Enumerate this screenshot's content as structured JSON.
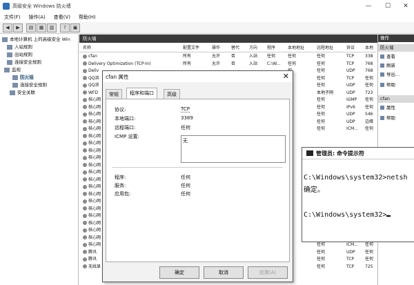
{
  "window": {
    "title": "高级安全 Windows 防火墙",
    "controls": [
      "—",
      "☐",
      "✕"
    ]
  },
  "menu": [
    "文件(F)",
    "操作(A)",
    "查看(V)",
    "帮助(H)"
  ],
  "toolbar": [
    "◀",
    "▶",
    "▤",
    "▦",
    "▥",
    "?",
    "▣"
  ],
  "tree": [
    {
      "label": "本地计算机 上的高级安全 Win"
    },
    {
      "label": "入站规则"
    },
    {
      "label": "出站规则"
    },
    {
      "label": "连接安全规则"
    },
    {
      "label": "监视"
    },
    {
      "label": "防火墙"
    },
    {
      "label": "连接安全规则"
    },
    {
      "label": "安全关联"
    }
  ],
  "main": {
    "header": "防火墙",
    "columns": [
      "名称",
      "配置文件",
      "操作",
      "替代",
      "方向",
      "程序",
      "本地地址",
      "远程地址",
      "协议",
      "本地"
    ],
    "rows": [
      [
        "cfan",
        "所有",
        "允许",
        "否",
        "入站",
        "任何",
        "任何",
        "任何",
        "TCP",
        "338"
      ],
      [
        "Delivery Optimization (TCP-In)",
        "所有",
        "允许",
        "否",
        "入站",
        "C:\\W...",
        "任何",
        "任何",
        "TCP",
        "768"
      ],
      [
        "Deliv",
        "",
        "",
        "",
        "",
        "",
        "何",
        "任何",
        "UDP",
        "768"
      ],
      [
        "QQ浏",
        "",
        "",
        "",
        "",
        "",
        "何",
        "任何",
        "TCP",
        "任何"
      ],
      [
        "QQ浏",
        "",
        "",
        "",
        "",
        "",
        "何",
        "任何",
        "UDP",
        "任何"
      ],
      [
        "WFD",
        "",
        "",
        "",
        "",
        "",
        "何",
        "本地子网",
        "UDP",
        "723"
      ],
      [
        "核心网",
        "",
        "",
        "",
        "",
        "",
        "何",
        "任何",
        "IGMP",
        "任何"
      ],
      [
        "核心网",
        "",
        "",
        "",
        "",
        "",
        "何",
        "任何",
        "IPv6",
        "任何"
      ],
      [
        "核心网",
        "",
        "",
        "",
        "",
        "",
        "何",
        "任何",
        "UDP",
        "546"
      ],
      [
        "核心网",
        "",
        "",
        "",
        "",
        "",
        "何",
        "任何",
        "UDP",
        "边缘"
      ],
      [
        "核心网",
        "",
        "",
        "",
        "",
        "",
        "何",
        "任何",
        "ICM...",
        "任何"
      ],
      [
        "核心网",
        "",
        "",
        "",
        "",
        "",
        "",
        "",
        "",
        ""
      ],
      [
        "核心网",
        "",
        "",
        "",
        "",
        "",
        "",
        "",
        "",
        ""
      ],
      [
        "核心网",
        "",
        "",
        "",
        "",
        "",
        "",
        "",
        "",
        ""
      ],
      [
        "核心网",
        "",
        "",
        "",
        "",
        "",
        "",
        "",
        "",
        ""
      ],
      [
        "核心网",
        "",
        "",
        "",
        "",
        "",
        "",
        "",
        "",
        ""
      ],
      [
        "核心网",
        "",
        "",
        "",
        "",
        "",
        "",
        "",
        "",
        ""
      ],
      [
        "核心网",
        "",
        "",
        "",
        "",
        "",
        "",
        "",
        "",
        ""
      ],
      [
        "核心网",
        "",
        "",
        "",
        "",
        "",
        "",
        "",
        "",
        ""
      ],
      [
        "核心网",
        "",
        "",
        "",
        "",
        "",
        "",
        "",
        "",
        ""
      ],
      [
        "核心网",
        "",
        "",
        "",
        "",
        "",
        "",
        "",
        "",
        ""
      ],
      [
        "核心网",
        "",
        "",
        "",
        "",
        "",
        "",
        "",
        "",
        ""
      ],
      [
        "核心网",
        "",
        "",
        "",
        "",
        "",
        "",
        "",
        "",
        ""
      ],
      [
        "核心网",
        "",
        "",
        "",
        "",
        "",
        "",
        "",
        "",
        ""
      ],
      [
        "核心网",
        "",
        "",
        "",
        "",
        "",
        "",
        "",
        "",
        ""
      ],
      [
        "核心网",
        "",
        "",
        "",
        "",
        "",
        "何",
        "任何",
        "ICM...",
        "任何"
      ],
      [
        "核心网",
        "",
        "",
        "",
        "",
        "",
        "何",
        "任何",
        "ICM...",
        "任何"
      ],
      [
        "腾讯",
        "",
        "",
        "",
        "",
        "",
        "何",
        "任何",
        "UDP",
        "任何"
      ],
      [
        "腾讯",
        "",
        "",
        "",
        "",
        "",
        "何",
        "任何",
        "TCP",
        "任何"
      ],
      [
        "无线显",
        "",
        "",
        "",
        "",
        "",
        "何",
        "任何",
        "TCP",
        "725"
      ]
    ]
  },
  "actions": {
    "header": "操作",
    "section1": "防火墙",
    "items1": [
      "查看",
      "刷新",
      "导出...",
      "帮助"
    ],
    "section2": "cfan",
    "items2": [
      "属性",
      "帮助"
    ]
  },
  "dialog": {
    "title": "cfan 属性",
    "close": "✕",
    "tabs": [
      "常规",
      "程序和端口",
      "高级"
    ],
    "fields": [
      {
        "label": "协议:",
        "value": "TCP"
      },
      {
        "label": "本地端口:",
        "value": "3389"
      },
      {
        "label": "远程端口:",
        "value": "任何"
      },
      {
        "label": "ICMP 设置:",
        "value": "无"
      }
    ],
    "fields2": [
      {
        "label": "程序:",
        "value": "任何"
      },
      {
        "label": "服务:",
        "value": "任何"
      },
      {
        "label": "应用包:",
        "value": "任何"
      }
    ],
    "buttons": {
      "ok": "确定",
      "cancel": "取消",
      "apply": "应用(A)"
    }
  },
  "cmd": {
    "title": "管理员: 命令提示符",
    "lines": [
      "C:\\Windows\\system32>netsh",
      "确定。",
      "C:\\Windows\\system32>"
    ]
  }
}
